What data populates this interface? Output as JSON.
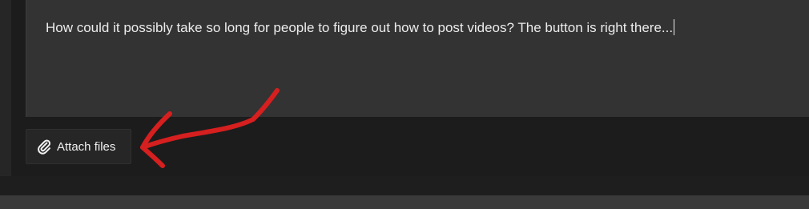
{
  "composer": {
    "message_text": "How could it possibly take so long for people to figure out how to post videos? The button is right there..."
  },
  "attach_button": {
    "label": "Attach files",
    "icon": "paperclip-icon"
  },
  "annotation": {
    "color": "#d61f1f",
    "shape": "hand-drawn-arrow"
  }
}
